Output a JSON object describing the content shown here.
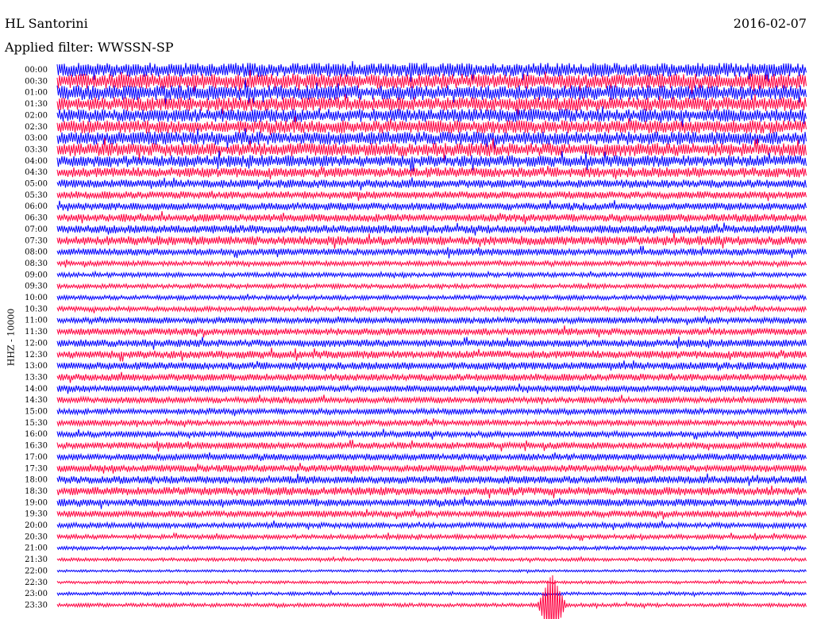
{
  "header": {
    "station": "HL Santorini",
    "date": "2016-02-07",
    "filter": "Applied filter: WWSSN-SP",
    "channel_label": "HHZ - 10000"
  },
  "chart_data": {
    "type": "line",
    "title": "HL Santorini",
    "subtitle": "Applied filter: WWSSN-SP",
    "ylabel": "HHZ - 10000",
    "xlabel": "",
    "row_labels": [
      "00:00",
      "00:30",
      "01:00",
      "01:30",
      "02:00",
      "02:30",
      "03:00",
      "03:30",
      "04:00",
      "04:30",
      "05:00",
      "05:30",
      "06:00",
      "06:30",
      "07:00",
      "07:30",
      "08:00",
      "08:30",
      "09:00",
      "09:30",
      "10:00",
      "10:30",
      "11:00",
      "11:30",
      "12:00",
      "12:30",
      "13:00",
      "13:30",
      "14:00",
      "14:30",
      "15:00",
      "15:30",
      "16:00",
      "16:30",
      "17:00",
      "17:30",
      "18:00",
      "18:30",
      "19:00",
      "19:30",
      "20:00",
      "20:30",
      "21:00",
      "21:30",
      "22:00",
      "22:30",
      "23:00",
      "23:30"
    ],
    "row_colors": [
      "#0000ff",
      "#ff0040"
    ],
    "relative_amplitude": [
      1.7,
      1.8,
      1.8,
      1.7,
      1.6,
      1.6,
      1.6,
      1.6,
      1.4,
      1.2,
      1.0,
      0.9,
      0.9,
      0.95,
      1.0,
      1.1,
      0.85,
      0.6,
      0.55,
      0.55,
      0.55,
      0.6,
      0.75,
      0.85,
      0.9,
      0.95,
      0.9,
      0.85,
      0.8,
      0.75,
      0.7,
      0.7,
      0.75,
      0.8,
      0.8,
      0.85,
      0.95,
      1.0,
      0.9,
      0.8,
      0.65,
      0.55,
      0.45,
      0.4,
      0.3,
      0.35,
      0.4,
      0.45
    ],
    "events": [
      {
        "row": "23:30",
        "relative_position": 0.66,
        "relative_amplitude": 2.4
      }
    ],
    "grid": false,
    "legend": "none"
  }
}
